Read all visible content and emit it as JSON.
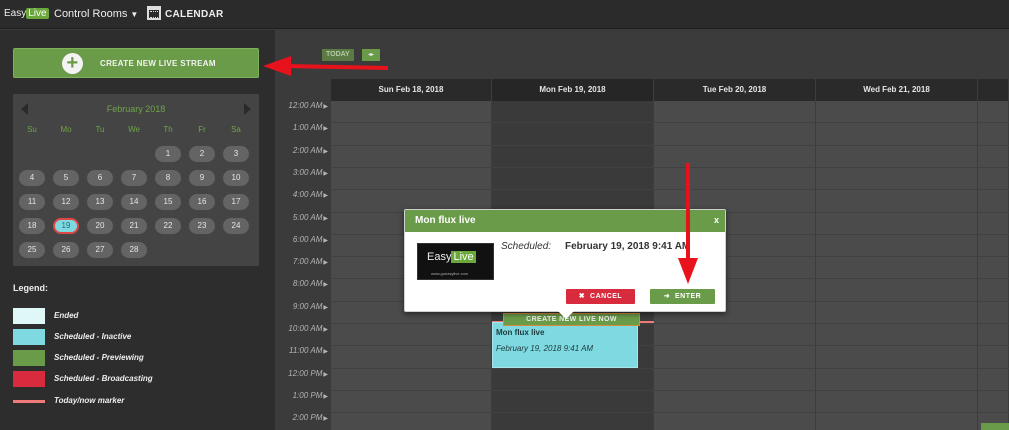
{
  "topbar": {
    "logo_easy": "Easy",
    "logo_live": "Live",
    "control_rooms": "Control Rooms",
    "calendar": "CALENDAR"
  },
  "left": {
    "create_button": "CREATE NEW LIVE STREAM",
    "minical": {
      "title": "February 2018",
      "dows": [
        "Su",
        "Mo",
        "Tu",
        "We",
        "Th",
        "Fr",
        "Sa"
      ],
      "weeks": [
        [
          "",
          "",
          "",
          "",
          "1",
          "2",
          "3"
        ],
        [
          "4",
          "5",
          "6",
          "7",
          "8",
          "9",
          "10"
        ],
        [
          "11",
          "12",
          "13",
          "14",
          "15",
          "16",
          "17"
        ],
        [
          "18",
          "19",
          "20",
          "21",
          "22",
          "23",
          "24"
        ],
        [
          "25",
          "26",
          "27",
          "28",
          "",
          "",
          ""
        ]
      ],
      "selected_day": "19"
    },
    "legend": {
      "title": "Legend:",
      "items": [
        {
          "label": "Ended",
          "color": "#e0f7f8"
        },
        {
          "label": "Scheduled - Inactive",
          "color": "#7fd9e0"
        },
        {
          "label": "Scheduled - Previewing",
          "color": "#6a9b49"
        },
        {
          "label": "Scheduled - Broadcasting",
          "color": "#d92b3e"
        }
      ],
      "marker_label": "Today/now marker",
      "marker_color": "#f07a7a"
    }
  },
  "calendar": {
    "today_button": "TODAY",
    "nav_arrows": "◂▸",
    "days": [
      "Sun Feb 18, 2018",
      "Mon Feb 19, 2018",
      "Tue Feb 20, 2018",
      "Wed Feb 21, 2018"
    ],
    "times": [
      "12:00 AM",
      "1:00 AM",
      "2:00 AM",
      "3:00 AM",
      "4:00 AM",
      "5:00 AM",
      "6:00 AM",
      "7:00 AM",
      "8:00 AM",
      "9:00 AM",
      "10:00 AM",
      "11:00 AM",
      "12:00 PM",
      "1:00 PM",
      "2:00 PM"
    ],
    "create_now": "CREATE NEW LIVE NOW",
    "event": {
      "title": "Mon flux live",
      "time": "February 19, 2018 9:41 AM"
    }
  },
  "popup": {
    "title": "Mon flux live",
    "close": "x",
    "logo_easy": "Easy",
    "logo_live": "Live",
    "logo_url": "www.goeasylive.com",
    "scheduled_label": "Scheduled:",
    "scheduled_value": "February 19, 2018 9:41 AM",
    "cancel": "CANCEL",
    "enter": "ENTER"
  },
  "colors": {
    "accent_green": "#6a9b49",
    "danger_red": "#d92b3e",
    "inactive_cyan": "#7fd9e0",
    "annotation_red": "#e8121c"
  }
}
